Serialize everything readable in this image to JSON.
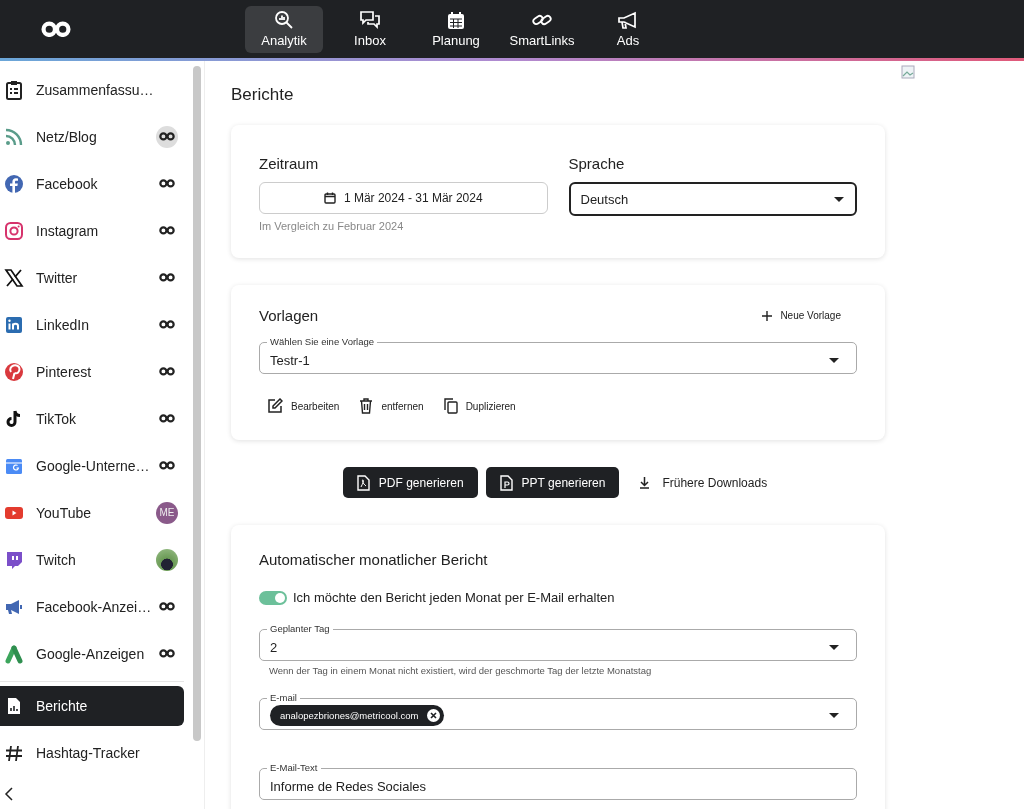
{
  "top_nav": {
    "tabs": [
      {
        "label": "Analytik",
        "kind": "analytics",
        "selected": true
      },
      {
        "label": "Inbox",
        "kind": "inbox",
        "selected": false
      },
      {
        "label": "Planung",
        "kind": "calendar",
        "selected": false
      },
      {
        "label": "SmartLinks",
        "kind": "link",
        "selected": false
      },
      {
        "label": "Ads",
        "kind": "megaphone",
        "selected": false
      }
    ]
  },
  "sidebar": {
    "items": [
      {
        "label": "Zusammenfassu…",
        "kind": "summary",
        "selected": false
      },
      {
        "label": "Netz/Blog",
        "kind": "rss",
        "badge": {
          "kind": "logo-circle"
        },
        "selected": false
      },
      {
        "label": "Facebook",
        "kind": "facebook",
        "badge": {
          "kind": "logo"
        },
        "selected": false
      },
      {
        "label": "Instagram",
        "kind": "instagram",
        "badge": {
          "kind": "logo"
        },
        "selected": false
      },
      {
        "label": "Twitter",
        "kind": "x",
        "badge": {
          "kind": "logo"
        },
        "selected": false
      },
      {
        "label": "LinkedIn",
        "kind": "linkedin",
        "badge": {
          "kind": "logo"
        },
        "selected": false
      },
      {
        "label": "Pinterest",
        "kind": "pinterest",
        "badge": {
          "kind": "logo"
        },
        "selected": false
      },
      {
        "label": "TikTok",
        "kind": "tiktok",
        "badge": {
          "kind": "logo"
        },
        "selected": false
      },
      {
        "label": "Google-Unterne…",
        "kind": "gbusiness",
        "badge": {
          "kind": "logo"
        },
        "selected": false
      },
      {
        "label": "YouTube",
        "kind": "youtube",
        "badge": {
          "kind": "initials",
          "initials": "ME"
        },
        "selected": false
      },
      {
        "label": "Twitch",
        "kind": "twitch",
        "badge": {
          "kind": "photo"
        },
        "selected": false
      },
      {
        "label": "Facebook-Anzei…",
        "kind": "fbads",
        "badge": {
          "kind": "logo"
        },
        "selected": false
      },
      {
        "label": "Google-Anzeigen",
        "kind": "gads",
        "badge": {
          "kind": "logo"
        },
        "selected": false
      },
      {
        "label": "Berichte",
        "kind": "report",
        "selected": true
      },
      {
        "label": "Hashtag-Tracker",
        "kind": "hashtag",
        "selected": false
      }
    ]
  },
  "page_title": "Berichte",
  "period_card": {
    "period_label": "Zeitraum",
    "date_range": "1 Mär 2024 - 31 Mär 2024",
    "comparison": "Im Vergleich zu Februar 2024",
    "language_label": "Sprache",
    "language": "Deutsch"
  },
  "templates_card": {
    "title": "Vorlagen",
    "new_button": "Neue Vorlage",
    "select_label": "Wählen Sie eine Vorlage",
    "select_value": "Testr-1",
    "actions": [
      {
        "label": "Bearbeiten",
        "kind": "edit"
      },
      {
        "label": "entfernen",
        "kind": "delete"
      },
      {
        "label": "Duplizieren",
        "kind": "copy"
      }
    ]
  },
  "generate_buttons": [
    {
      "label": "PDF generieren",
      "kind": "pdf"
    },
    {
      "label": "PPT generieren",
      "kind": "ppt"
    }
  ],
  "downloads_link": "Frühere Downloads",
  "monthly_card": {
    "title": "Automatischer monatlicher Bericht",
    "toggle": {
      "label": "Ich möchte den Bericht jeden Monat per E-Mail erhalten",
      "on": true
    },
    "day_label": "Geplanter Tag",
    "day_value": "2",
    "day_hint": "Wenn der Tag in einem Monat nicht existiert, wird der geschmorte Tag der letzte Monatstag",
    "email_label": "E-mail",
    "emails": [
      "analopezbriones@metricool.com"
    ],
    "text_label": "E-Mail-Text",
    "text_value": "Informe de Redes Sociales"
  }
}
